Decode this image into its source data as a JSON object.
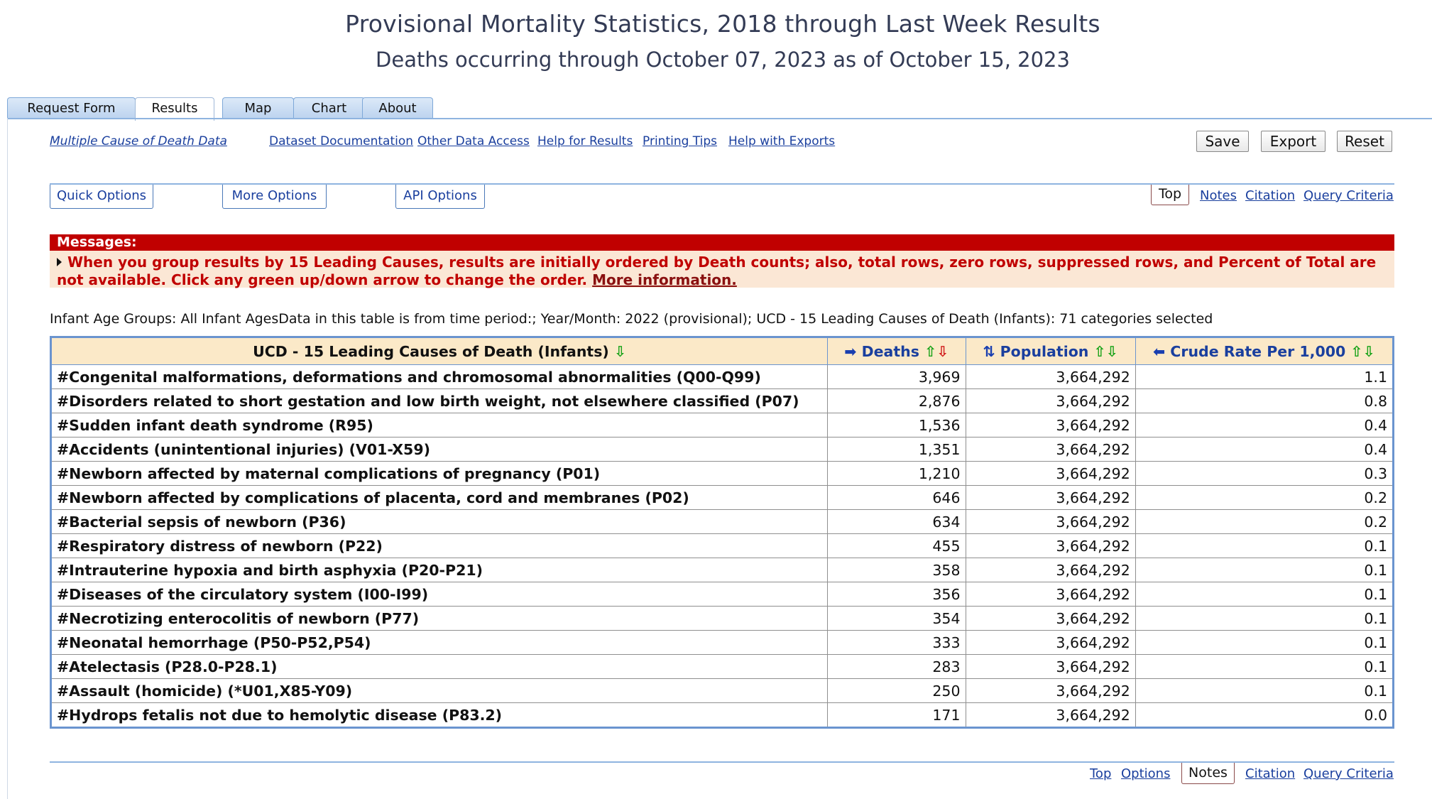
{
  "header": {
    "title": "Provisional Mortality Statistics, 2018 through Last Week Results",
    "subtitle": "Deaths occurring through October 07, 2023 as of October 15, 2023"
  },
  "tabs": [
    {
      "label": "Request Form",
      "active": false
    },
    {
      "label": "Results",
      "active": true
    },
    {
      "label": "Map",
      "active": false
    },
    {
      "label": "Chart",
      "active": false
    },
    {
      "label": "About",
      "active": false
    }
  ],
  "links": {
    "multiple_cause": "Multiple Cause of Death Data",
    "dataset_doc": "Dataset Documentation",
    "other_data": "Other Data Access",
    "help_results": "Help for Results",
    "printing_tips": "Printing Tips",
    "help_exports": "Help with Exports"
  },
  "buttons": {
    "save": "Save",
    "export": "Export",
    "reset": "Reset"
  },
  "options": {
    "quick": "Quick Options",
    "more": "More Options",
    "api": "API Options"
  },
  "nav": {
    "top": "Top",
    "notes": "Notes",
    "citation": "Citation",
    "query": "Query Criteria",
    "options": "Options"
  },
  "messages": {
    "heading": "Messages:",
    "text": "When you group results by 15 Leading Causes, results are initially ordered by Death counts; also, total rows, zero rows, suppressed rows, and Percent of Total are not available. Click any green up/down arrow to change the order.",
    "more_link": "More information."
  },
  "caption": "Infant Age Groups: All Infant AgesData in this table is from time period:; Year/Month: 2022 (provisional); UCD - 15 Leading Causes of Death (Infants): 71 categories selected",
  "table": {
    "columns": [
      "UCD - 15 Leading Causes of Death (Infants)",
      "Deaths",
      "Population",
      "Crude Rate Per 1,000"
    ],
    "rows": [
      [
        "#Congenital malformations, deformations and chromosomal abnormalities (Q00-Q99)",
        "3,969",
        "3,664,292",
        "1.1"
      ],
      [
        "#Disorders related to short gestation and low birth weight, not elsewhere classified (P07)",
        "2,876",
        "3,664,292",
        "0.8"
      ],
      [
        "#Sudden infant death syndrome (R95)",
        "1,536",
        "3,664,292",
        "0.4"
      ],
      [
        "#Accidents (unintentional injuries) (V01-X59)",
        "1,351",
        "3,664,292",
        "0.4"
      ],
      [
        "#Newborn affected by maternal complications of pregnancy (P01)",
        "1,210",
        "3,664,292",
        "0.3"
      ],
      [
        "#Newborn affected by complications of placenta, cord and membranes (P02)",
        "646",
        "3,664,292",
        "0.2"
      ],
      [
        "#Bacterial sepsis of newborn (P36)",
        "634",
        "3,664,292",
        "0.2"
      ],
      [
        "#Respiratory distress of newborn (P22)",
        "455",
        "3,664,292",
        "0.1"
      ],
      [
        "#Intrauterine hypoxia and birth asphyxia (P20-P21)",
        "358",
        "3,664,292",
        "0.1"
      ],
      [
        "#Diseases of the circulatory system (I00-I99)",
        "356",
        "3,664,292",
        "0.1"
      ],
      [
        "#Necrotizing enterocolitis of newborn (P77)",
        "354",
        "3,664,292",
        "0.1"
      ],
      [
        "#Neonatal hemorrhage (P50-P52,P54)",
        "333",
        "3,664,292",
        "0.1"
      ],
      [
        "#Atelectasis (P28.0-P28.1)",
        "283",
        "3,664,292",
        "0.1"
      ],
      [
        "#Assault (homicide) (*U01,X85-Y09)",
        "250",
        "3,664,292",
        "0.1"
      ],
      [
        "#Hydrops fetalis not due to hemolytic disease (P83.2)",
        "171",
        "3,664,292",
        "0.0"
      ]
    ]
  }
}
